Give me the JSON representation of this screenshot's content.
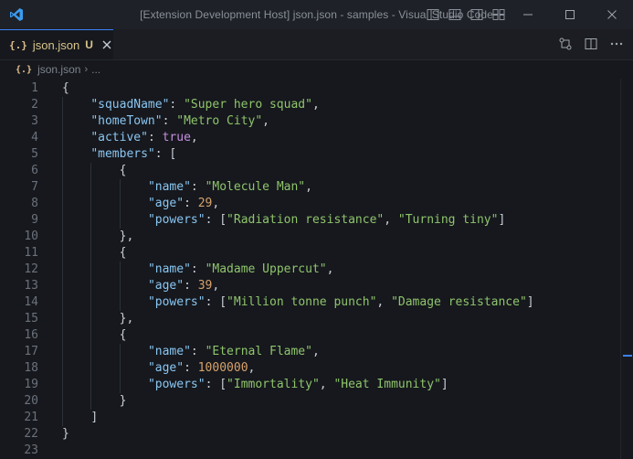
{
  "window": {
    "title": "[Extension Development Host] json.json - samples - Visual Studio Code"
  },
  "tab": {
    "icon_glyph": "{.}",
    "label": "json.json",
    "status": "U",
    "icon": "json-file-icon"
  },
  "breadcrumb": {
    "icon_glyph": "{.}",
    "file": "json.json",
    "separator": "›",
    "rest": "..."
  },
  "colors": {
    "accent": "#3a82f7",
    "key": "#8ac6f2",
    "string": "#8fc46c",
    "number": "#d7a26b",
    "keyword": "#c68fe0"
  },
  "code_lines": [
    {
      "n": "1",
      "indent": 0,
      "tokens": [
        [
          "pun",
          "{"
        ]
      ]
    },
    {
      "n": "2",
      "indent": 1,
      "tokens": [
        [
          "key",
          "\"squadName\""
        ],
        [
          "pun",
          ": "
        ],
        [
          "str",
          "\"Super hero squad\""
        ],
        [
          "pun",
          ","
        ]
      ]
    },
    {
      "n": "3",
      "indent": 1,
      "tokens": [
        [
          "key",
          "\"homeTown\""
        ],
        [
          "pun",
          ": "
        ],
        [
          "str",
          "\"Metro City\""
        ],
        [
          "pun",
          ","
        ]
      ]
    },
    {
      "n": "4",
      "indent": 1,
      "tokens": [
        [
          "key",
          "\"active\""
        ],
        [
          "pun",
          ": "
        ],
        [
          "kw",
          "true"
        ],
        [
          "pun",
          ","
        ]
      ]
    },
    {
      "n": "5",
      "indent": 1,
      "tokens": [
        [
          "key",
          "\"members\""
        ],
        [
          "pun",
          ": ["
        ]
      ]
    },
    {
      "n": "6",
      "indent": 2,
      "tokens": [
        [
          "pun",
          "{"
        ]
      ]
    },
    {
      "n": "7",
      "indent": 3,
      "tokens": [
        [
          "key",
          "\"name\""
        ],
        [
          "pun",
          ": "
        ],
        [
          "str",
          "\"Molecule Man\""
        ],
        [
          "pun",
          ","
        ]
      ]
    },
    {
      "n": "8",
      "indent": 3,
      "tokens": [
        [
          "key",
          "\"age\""
        ],
        [
          "pun",
          ": "
        ],
        [
          "num",
          "29"
        ],
        [
          "pun",
          ","
        ]
      ]
    },
    {
      "n": "9",
      "indent": 3,
      "tokens": [
        [
          "key",
          "\"powers\""
        ],
        [
          "pun",
          ": ["
        ],
        [
          "str",
          "\"Radiation resistance\""
        ],
        [
          "pun",
          ", "
        ],
        [
          "str",
          "\"Turning tiny\""
        ],
        [
          "pun",
          "]"
        ]
      ]
    },
    {
      "n": "10",
      "indent": 2,
      "tokens": [
        [
          "pun",
          "},"
        ]
      ]
    },
    {
      "n": "11",
      "indent": 2,
      "tokens": [
        [
          "pun",
          "{"
        ]
      ]
    },
    {
      "n": "12",
      "indent": 3,
      "tokens": [
        [
          "key",
          "\"name\""
        ],
        [
          "pun",
          ": "
        ],
        [
          "str",
          "\"Madame Uppercut\""
        ],
        [
          "pun",
          ","
        ]
      ]
    },
    {
      "n": "13",
      "indent": 3,
      "tokens": [
        [
          "key",
          "\"age\""
        ],
        [
          "pun",
          ": "
        ],
        [
          "num",
          "39"
        ],
        [
          "pun",
          ","
        ]
      ]
    },
    {
      "n": "14",
      "indent": 3,
      "tokens": [
        [
          "key",
          "\"powers\""
        ],
        [
          "pun",
          ": ["
        ],
        [
          "str",
          "\"Million tonne punch\""
        ],
        [
          "pun",
          ", "
        ],
        [
          "str",
          "\"Damage resistance\""
        ],
        [
          "pun",
          "]"
        ]
      ]
    },
    {
      "n": "15",
      "indent": 2,
      "tokens": [
        [
          "pun",
          "},"
        ]
      ]
    },
    {
      "n": "16",
      "indent": 2,
      "tokens": [
        [
          "pun",
          "{"
        ]
      ]
    },
    {
      "n": "17",
      "indent": 3,
      "tokens": [
        [
          "key",
          "\"name\""
        ],
        [
          "pun",
          ": "
        ],
        [
          "str",
          "\"Eternal Flame\""
        ],
        [
          "pun",
          ","
        ]
      ]
    },
    {
      "n": "18",
      "indent": 3,
      "tokens": [
        [
          "key",
          "\"age\""
        ],
        [
          "pun",
          ": "
        ],
        [
          "num",
          "1000000"
        ],
        [
          "pun",
          ","
        ]
      ]
    },
    {
      "n": "19",
      "indent": 3,
      "tokens": [
        [
          "key",
          "\"powers\""
        ],
        [
          "pun",
          ": ["
        ],
        [
          "str",
          "\"Immortality\""
        ],
        [
          "pun",
          ", "
        ],
        [
          "str",
          "\"Heat Immunity\""
        ],
        [
          "pun",
          "]"
        ]
      ]
    },
    {
      "n": "20",
      "indent": 2,
      "tokens": [
        [
          "pun",
          "}"
        ]
      ]
    },
    {
      "n": "21",
      "indent": 1,
      "tokens": [
        [
          "pun",
          "]"
        ]
      ]
    },
    {
      "n": "22",
      "indent": 0,
      "tokens": [
        [
          "pun",
          "}"
        ]
      ]
    },
    {
      "n": "23",
      "indent": 0,
      "tokens": []
    }
  ]
}
